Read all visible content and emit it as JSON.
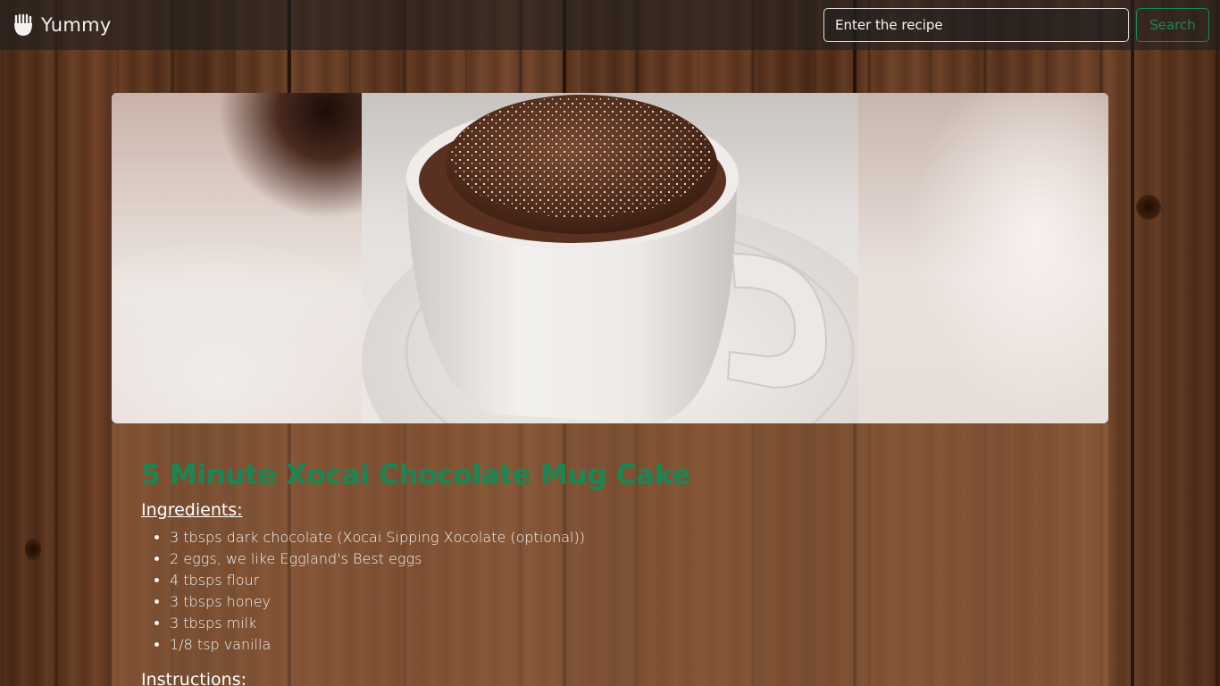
{
  "navbar": {
    "brand": "Yummy",
    "brand_icon": "hand-food-icon",
    "search_placeholder": "Enter the recipe",
    "search_button": "Search",
    "accent_color": "#198754"
  },
  "recipe": {
    "title": "5 Minute Xocai Chocolate Mug Cake",
    "ingredients_heading": "Ingredients:",
    "ingredients": [
      "3 tbsps dark chocolate (Xocai Sipping Xocolate (optional))",
      "2 eggs, we like Eggland's Best eggs",
      "4 tbsps flour",
      "3 tbsps honey",
      "3 tbsps milk",
      "1/8 tsp vanilla"
    ],
    "instructions_heading": "Instructions:"
  }
}
